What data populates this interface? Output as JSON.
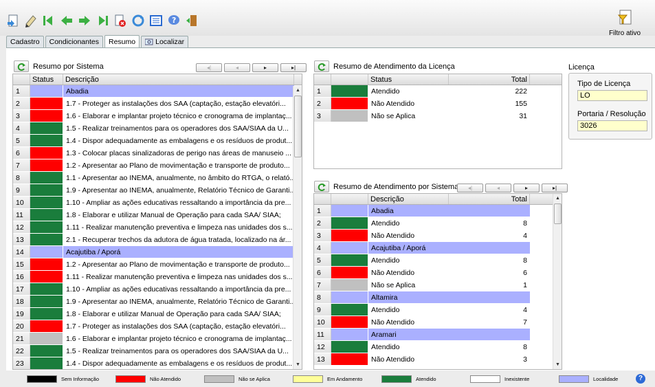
{
  "toolbar": {
    "icons": [
      "new-icon",
      "edit-icon",
      "first-icon",
      "prev-icon",
      "next-icon",
      "last-icon",
      "delete-icon",
      "refresh-icon",
      "list-icon",
      "help-icon",
      "exit-icon"
    ],
    "filtro_label": "Filtro ativo"
  },
  "tabs": [
    {
      "label": "Cadastro"
    },
    {
      "label": "Condicionantes"
    },
    {
      "label": "Resumo"
    },
    {
      "label": "Localizar"
    }
  ],
  "colors": {
    "atendido": "#1a7d3c",
    "nao_atendido": "#ff0000",
    "nao_se_aplica": "#c0c0c0",
    "localidade": "#aab0ff",
    "em_andamento": "#ffff99",
    "sem_informacao": "#000000",
    "inexistente": "#ffffff"
  },
  "resumo_sistema": {
    "title": "Resumo por Sistema",
    "col_status": "Status",
    "col_desc": "Descrição",
    "rows": [
      {
        "n": "1",
        "s": "loc",
        "d": "Abadia"
      },
      {
        "n": "2",
        "s": "red",
        "d": "1.7 - Proteger as instalações dos SAA (captação, estação elevatóri..."
      },
      {
        "n": "3",
        "s": "red",
        "d": "1.6 - Elaborar e implantar projeto técnico e cronograma de implantaç..."
      },
      {
        "n": "4",
        "s": "green",
        "d": "1.5 - Realizar treinamentos para os operadores dos SAA/SIAA da U..."
      },
      {
        "n": "5",
        "s": "green",
        "d": "1.4 - Dispor adequadamente as embalagens e os resíduos de produt..."
      },
      {
        "n": "6",
        "s": "red",
        "d": "1.3 - Colocar placas sinalizadoras de perigo nas áreas de manuseio ..."
      },
      {
        "n": "7",
        "s": "red",
        "d": "1.2 - Apresentar ao Plano de movimentação e transporte de produto..."
      },
      {
        "n": "8",
        "s": "green",
        "d": "1.1 - Apresentar ao INEMA, anualmente, no âmbito do RTGA, o relató..."
      },
      {
        "n": "9",
        "s": "green",
        "d": "1.9 - Apresentar ao INEMA, anualmente, Relatório Técnico de Garanti..."
      },
      {
        "n": "10",
        "s": "green",
        "d": "1.10 - Ampliar as ações educativas ressaltando a importância da pre..."
      },
      {
        "n": "11",
        "s": "green",
        "d": "1.8 - Elaborar e utilizar Manual de Operação para cada SAA/ SIAA;"
      },
      {
        "n": "12",
        "s": "green",
        "d": "1.11 - Realizar manutenção preventiva e limpeza nas unidades dos s..."
      },
      {
        "n": "13",
        "s": "green",
        "d": "2.1 - Recuperar trechos da adutora de água tratada, localizado na ár..."
      },
      {
        "n": "14",
        "s": "loc",
        "d": "Acajutiba / Aporá"
      },
      {
        "n": "15",
        "s": "red",
        "d": "1.2 - Apresentar ao Plano de movimentação e transporte de produto..."
      },
      {
        "n": "16",
        "s": "red",
        "d": "1.11 - Realizar manutenção preventiva e limpeza nas unidades dos s..."
      },
      {
        "n": "17",
        "s": "green",
        "d": "1.10 - Ampliar as ações educativas ressaltando a importância da pre..."
      },
      {
        "n": "18",
        "s": "green",
        "d": "1.9 - Apresentar ao INEMA, anualmente, Relatório Técnico de Garanti..."
      },
      {
        "n": "19",
        "s": "green",
        "d": "1.8 - Elaborar e utilizar Manual de Operação para cada SAA/ SIAA;"
      },
      {
        "n": "20",
        "s": "red",
        "d": "1.7 - Proteger as instalações dos SAA (captação, estação elevatóri..."
      },
      {
        "n": "21",
        "s": "gray",
        "d": "1.6 - Elaborar e implantar projeto técnico e cronograma de implantaç..."
      },
      {
        "n": "22",
        "s": "green",
        "d": "1.5 - Realizar treinamentos para os operadores dos SAA/SIAA da U..."
      },
      {
        "n": "23",
        "s": "green",
        "d": "1.4 - Dispor adequadamente as embalagens e os resíduos de produt..."
      }
    ]
  },
  "resumo_licenca": {
    "title": "Resumo de Atendimento da Licença",
    "col_status": "Status",
    "col_total": "Total",
    "rows": [
      {
        "n": "1",
        "s": "green",
        "d": "Atendido",
        "t": "222"
      },
      {
        "n": "2",
        "s": "red",
        "d": "Não Atendido",
        "t": "155"
      },
      {
        "n": "3",
        "s": "gray",
        "d": "Não se Aplica",
        "t": "31"
      }
    ]
  },
  "resumo_atend_sistema": {
    "title": "Resumo de Atendimento por Sistema",
    "col_desc": "Descrição",
    "col_total": "Total",
    "rows": [
      {
        "n": "1",
        "s": "loc",
        "d": "Abadia",
        "t": ""
      },
      {
        "n": "2",
        "s": "green",
        "d": "Atendido",
        "t": "8"
      },
      {
        "n": "3",
        "s": "red",
        "d": "Não Atendido",
        "t": "4"
      },
      {
        "n": "4",
        "s": "loc",
        "d": "Acajutiba / Aporá",
        "t": ""
      },
      {
        "n": "5",
        "s": "green",
        "d": "Atendido",
        "t": "8"
      },
      {
        "n": "6",
        "s": "red",
        "d": "Não Atendido",
        "t": "6"
      },
      {
        "n": "7",
        "s": "gray",
        "d": "Não se Aplica",
        "t": "1"
      },
      {
        "n": "8",
        "s": "loc",
        "d": "Altamira",
        "t": ""
      },
      {
        "n": "9",
        "s": "green",
        "d": "Atendido",
        "t": "4"
      },
      {
        "n": "10",
        "s": "red",
        "d": "Não Atendido",
        "t": "7"
      },
      {
        "n": "11",
        "s": "loc",
        "d": "Aramari",
        "t": ""
      },
      {
        "n": "12",
        "s": "green",
        "d": "Atendido",
        "t": "8"
      },
      {
        "n": "13",
        "s": "red",
        "d": "Não Atendido",
        "t": "3"
      }
    ]
  },
  "licenca": {
    "title": "Licença",
    "tipo_label": "Tipo de Licença",
    "tipo_value": "LO",
    "portaria_label": "Portaria / Resolução",
    "portaria_value": "3026"
  },
  "legend": [
    {
      "label": "Sem Informação",
      "color": "#000000"
    },
    {
      "label": "Não Atendido",
      "color": "#ff0000"
    },
    {
      "label": "Não se Aplica",
      "color": "#c0c0c0"
    },
    {
      "label": "Em Andamento",
      "color": "#ffff99"
    },
    {
      "label": "Atendido",
      "color": "#1a7d3c"
    },
    {
      "label": "Inexistente",
      "color": "#ffffff"
    },
    {
      "label": "Localidade",
      "color": "#aab0ff"
    }
  ]
}
